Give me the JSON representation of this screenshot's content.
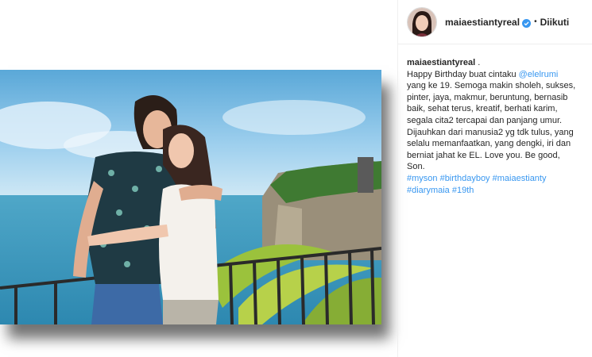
{
  "post": {
    "username": "maiaestiantyreal",
    "separator": "•",
    "follow_status": "Diikuti"
  },
  "caption": {
    "author": "maiaestiantyreal",
    "author_suffix": " .",
    "line1_prefix": "Happy Birthday buat cintaku ",
    "mention": "@elelrumi",
    "lines": [
      "yang ke 19. Semoga makin sholeh, sukses,",
      "pinter, jaya, makmur, beruntung, bernasib",
      "baik, sehat terus, kreatif, berhati karim,",
      "segala cita2 tercapai dan panjang umur.",
      "Dijauhkan dari manusia2 yg tdk tulus, yang",
      "selalu memanfaatkan, yang dengki, iri dan",
      "berniat jahat ke EL. Love you. Be good,",
      "Son."
    ],
    "hashtags_line1": "#myson #birthdayboy #maiaestianty",
    "hashtags_line2": "#diarymaia #19th"
  },
  "colors": {
    "link": "#3897f0",
    "text": "#262626",
    "verified": "#3897f0"
  },
  "icons": {
    "verified": "verified-badge-icon"
  }
}
